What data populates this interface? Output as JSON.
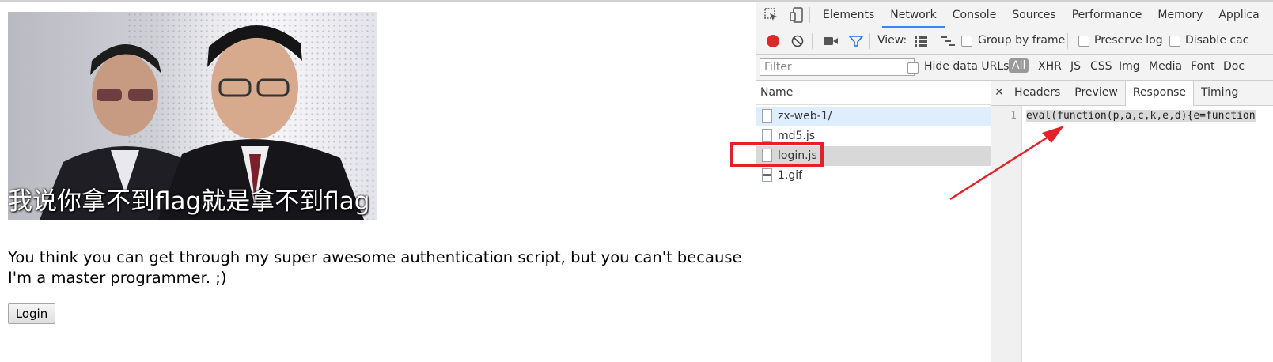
{
  "page": {
    "meme_caption": "我说你拿不到flag就是拿不到flag",
    "message": "You think you can get through my super awesome authentication script, but you can't because I'm a master programmer. ;)",
    "login_label": "Login"
  },
  "devtools": {
    "tabs": [
      "Elements",
      "Network",
      "Console",
      "Sources",
      "Performance",
      "Memory",
      "Applica"
    ],
    "active_tab": "Network",
    "toolbar": {
      "view_label": "View:",
      "group_by_frame": "Group by frame",
      "preserve_log": "Preserve log",
      "disable_cache": "Disable cac"
    },
    "filter": {
      "placeholder": "Filter",
      "hide_data_urls": "Hide data URLs",
      "types": [
        "All",
        "XHR",
        "JS",
        "CSS",
        "Img",
        "Media",
        "Font",
        "Doc"
      ]
    },
    "name_header": "Name",
    "requests": [
      {
        "name": "zx-web-1/"
      },
      {
        "name": "md5.js"
      },
      {
        "name": "login.js"
      },
      {
        "name": "1.gif"
      }
    ],
    "detail_tabs": [
      "Headers",
      "Preview",
      "Response",
      "Timing"
    ],
    "active_detail_tab": "Response",
    "response": {
      "line_number": "1",
      "code": "eval(function(p,a,c,k,e,d){e=function"
    }
  },
  "colors": {
    "accent": "#3e82f7",
    "annotation": "#e42129",
    "record": "#d82a2a"
  }
}
